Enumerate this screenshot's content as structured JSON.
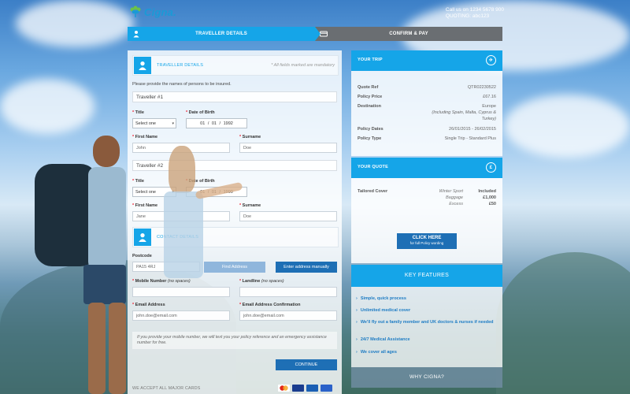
{
  "header": {
    "brand": "Cigna.",
    "contact_line": "Call us on 1234 5678 900",
    "quoting_line": "QUOTING: abc123"
  },
  "steps": [
    {
      "label": "TRAVELLER DETAILS",
      "icon": "person-icon"
    },
    {
      "label": "CONFIRM & PAY",
      "icon": "card-icon"
    }
  ],
  "form": {
    "section_title": "TRAVELLER DETAILS",
    "mandatory_note": "* All fields marked are mandatory",
    "intro": "Please provide the names of persons to be insured.",
    "travellers": [
      {
        "heading": "Traveller #1",
        "title_label": "Title",
        "title_value": "Select one",
        "dob_label": "Date of Birth",
        "dob_value": "01 / 01 / 1992",
        "first_label": "First Name",
        "first_value": "John",
        "surname_label": "Surname",
        "surname_value": "Doe"
      },
      {
        "heading": "Traveller #2",
        "title_label": "Title",
        "title_value": "Select one",
        "dob_label": "Date of Birth",
        "dob_value": "01 / 01 / 1990",
        "first_label": "First Name",
        "first_value": "Jane",
        "surname_label": "Surname",
        "surname_value": "Doe"
      }
    ],
    "contact_title": "CONTACT DETAILS",
    "postcode_label": "Postcode",
    "postcode_value": "PA15 4RJ",
    "find_address": "Find Address",
    "enter_manually": "Enter address manually",
    "mobile_label": "Mobile Number",
    "mobile_hint": "(no spaces)",
    "landline_label": "Landline",
    "landline_hint": "(no spaces)",
    "email_label": "Email Address",
    "email_value": "john.doe@email.com",
    "email_confirm_label": "Email Address Confirmation",
    "email_confirm_value": "john.doe@email.com",
    "sms_note": "If you provide your mobile number, we will text you your policy reference and an emergency assistance number for free.",
    "continue": "CONTINUE",
    "cards_text": "WE ACCEPT ALL MAJOR CARDS"
  },
  "trip": {
    "title": "YOUR TRIP",
    "rows": [
      {
        "k": "Quote Ref",
        "v": "QTR02230522"
      },
      {
        "k": "Policy Price",
        "v": "£67.16"
      },
      {
        "k": "Destination",
        "v": "Europe"
      },
      {
        "k": "",
        "v": "(Including Spain, Malta, Cyprus &"
      },
      {
        "k": "",
        "v": "Turkey)"
      },
      {
        "k": "Policy Dates",
        "v": "26/01/2015 - 26/02/2015"
      },
      {
        "k": "Policy Type",
        "v": "Single Trip - Standard Plus"
      }
    ]
  },
  "quote": {
    "title": "YOUR QUOTE",
    "cover_label": "Tailored Cover",
    "items": [
      {
        "name": "Winter Sport",
        "value": "Included"
      },
      {
        "name": "Baggage",
        "value": "£1,000"
      },
      {
        "name": "Excess",
        "value": "£50"
      }
    ],
    "click_here": "CLICK HERE",
    "click_sub": "for full Policy wording"
  },
  "features": {
    "title": "KEY FEATURES",
    "items": [
      "Simple, quick process",
      "Unlimited medical cover",
      "We'll fly out a family member and UK doctors & nurses if needed",
      "24/7 Medical Assistance",
      "We cover all ages"
    ]
  },
  "why": "WHY CIGNA?",
  "colors": {
    "accent": "#15a5e8",
    "button": "#1e6fb5",
    "inactive": "#6a6e72"
  }
}
